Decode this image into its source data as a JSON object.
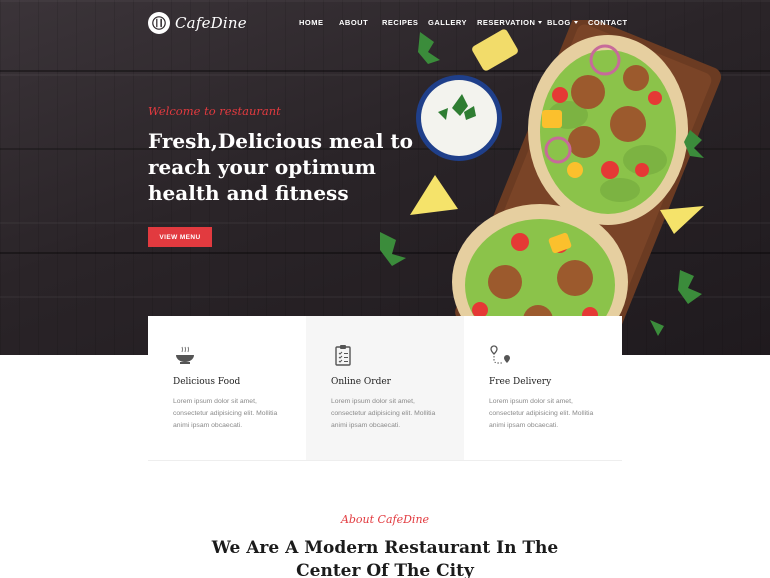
{
  "brand": {
    "name": "CafeDine"
  },
  "nav": {
    "items": [
      {
        "label": "HOME"
      },
      {
        "label": "ABOUT"
      },
      {
        "label": "RECIPES"
      },
      {
        "label": "GALLERY"
      },
      {
        "label": "RESERVATION"
      },
      {
        "label": "BLOG"
      },
      {
        "label": "CONTACT"
      }
    ]
  },
  "hero": {
    "kicker": "Welcome to restaurant",
    "headline": "Fresh,Delicious meal to reach your optimum health and fitness",
    "cta_label": "VIEW MENU"
  },
  "features": [
    {
      "icon": "bowl-icon",
      "title": "Delicious Food",
      "text": "Lorem ipsum dolor sit amet, consectetur adipisicing elit. Mollitia animi ipsam obcaecati."
    },
    {
      "icon": "clipboard-icon",
      "title": "Online Order",
      "text": "Lorem ipsum dolor sit amet, consectetur adipisicing elit. Mollitia animi ipsam obcaecati."
    },
    {
      "icon": "route-pin-icon",
      "title": "Free Delivery",
      "text": "Lorem ipsum dolor sit amet, consectetur adipisicing elit. Mollitia animi ipsam obcaecati."
    }
  ],
  "about": {
    "kicker": "About CafeDine",
    "title": "We Are A Modern Restaurant In The Center Of The City"
  },
  "colors": {
    "accent": "#e23a3f",
    "hero_bg": "#2a2428",
    "panel_alt": "#f6f6f6"
  }
}
